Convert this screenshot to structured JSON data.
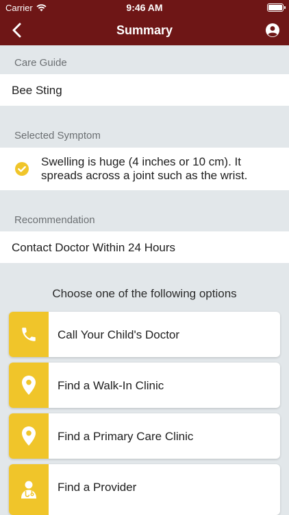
{
  "status_bar": {
    "carrier": "Carrier",
    "time": "9:46 AM"
  },
  "nav": {
    "title": "Summary"
  },
  "care_guide": {
    "header": "Care Guide",
    "value": "Bee Sting"
  },
  "symptom": {
    "header": "Selected Symptom",
    "line1": "Swelling is huge (4 inches or 10 cm). It",
    "line2": "spreads across a joint such as the wrist."
  },
  "recommendation": {
    "header": "Recommendation",
    "value": "Contact Doctor Within 24 Hours"
  },
  "options": {
    "prompt": "Choose one of the following options",
    "items": [
      {
        "label": "Call Your Child's Doctor",
        "icon": "phone-icon"
      },
      {
        "label": "Find a Walk-In Clinic",
        "icon": "location-pin-icon"
      },
      {
        "label": "Find a Primary Care Clinic",
        "icon": "location-pin-icon"
      },
      {
        "label": "Find a Provider",
        "icon": "doctor-icon"
      }
    ]
  },
  "colors": {
    "brand": "#6e1616",
    "accent": "#f0c52a",
    "background": "#e2e7ea"
  }
}
